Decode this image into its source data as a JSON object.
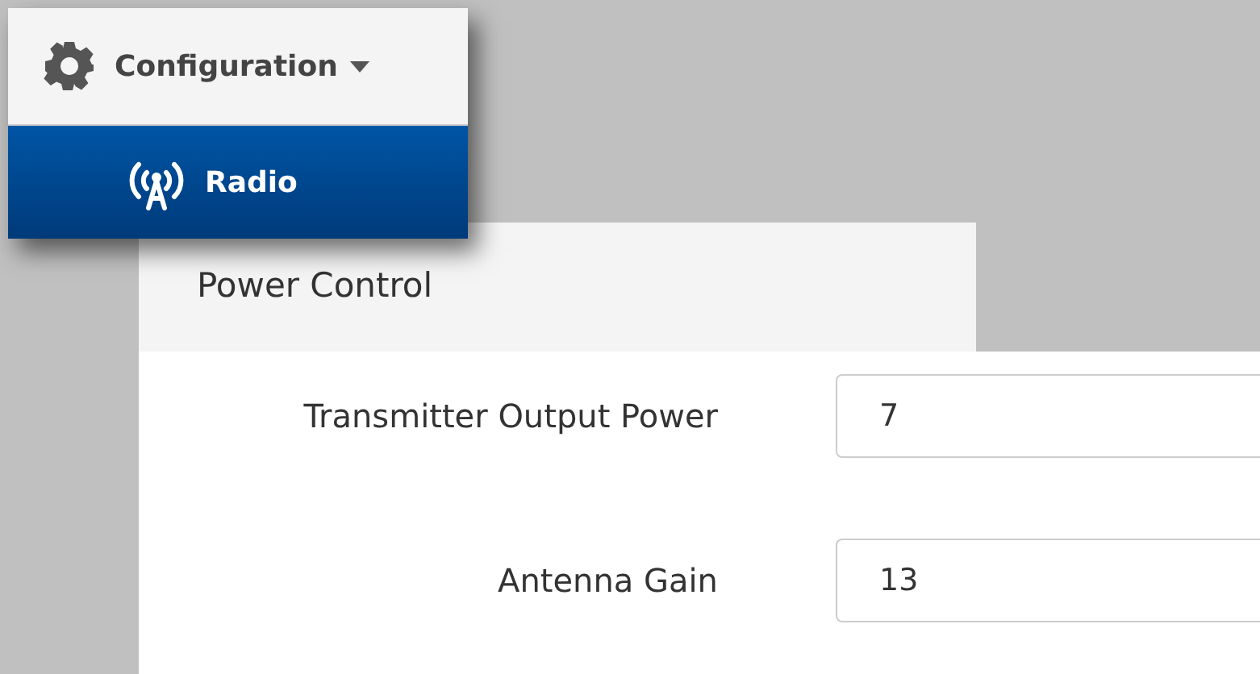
{
  "menu": {
    "title": "Configuration",
    "expanded": true,
    "items": [
      {
        "label": "Radio",
        "selected": true
      }
    ]
  },
  "section": {
    "title": "Power Control",
    "fields": [
      {
        "label": "Transmitter Output Power",
        "value": "7"
      },
      {
        "label": "Antenna Gain",
        "value": "13"
      }
    ]
  }
}
